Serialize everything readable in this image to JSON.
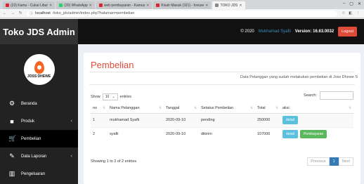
{
  "browser": {
    "tabs": [
      {
        "label": "(23) Kamu - Cukai Libur"
      },
      {
        "label": "(20) WhatsApp"
      },
      {
        "label": "web pembayaran - Kamus"
      },
      {
        "label": "Kisah Masuk (321) - fovuxe"
      },
      {
        "label": "TOKO JDS"
      }
    ],
    "url_host": "localhost",
    "url_path": "/toko_jds/admin/index.php?halaman=pembelian"
  },
  "header": {
    "logo": "Toko JDS Admin",
    "copyright": "© 2020",
    "owner": "Mukhamad Syafii",
    "version": "Version: 16.63.0032",
    "logout": "Logout"
  },
  "sidebar": {
    "brand_text": "JOSS DHEWE",
    "items": [
      {
        "label": "Beranda",
        "icon": "dashboard-icon",
        "glyph": "⚙"
      },
      {
        "label": "Produk",
        "icon": "box-icon",
        "glyph": "■"
      },
      {
        "label": "Pembelian",
        "icon": "cart-icon",
        "glyph": "🛒"
      },
      {
        "label": "Data Laporan",
        "icon": "edit-icon",
        "glyph": "✎"
      },
      {
        "label": "Pengeluaran",
        "icon": "bar-chart-icon",
        "glyph": "▥"
      }
    ]
  },
  "main": {
    "title": "Pembelian",
    "notice": "Data Pelanggan yang sudah melakukan pembelian di Joss Dhewe S",
    "show_label": "Show",
    "show_value": "10",
    "entries_label": "entries",
    "search_label": "Search:",
    "columns": [
      "no",
      "Nama Pelanggan",
      "Tanggal",
      "Setatus Pembelian",
      "Total",
      "aksi"
    ],
    "rows": [
      {
        "no": "1",
        "nama": "mukhamad Syafii",
        "tanggal": "2020-09-10",
        "status": "pending",
        "total": "250000",
        "actions": [
          "detail"
        ]
      },
      {
        "no": "2",
        "nama": "syafii",
        "tanggal": "2020-09-10",
        "status": "dikirim",
        "total": "107000",
        "actions": [
          "detail",
          "Pembayaran"
        ]
      }
    ],
    "info": "Showing 1 to 2 of 2 entries",
    "pager": {
      "previous": "Previous",
      "current": "1",
      "next": "Next"
    }
  }
}
